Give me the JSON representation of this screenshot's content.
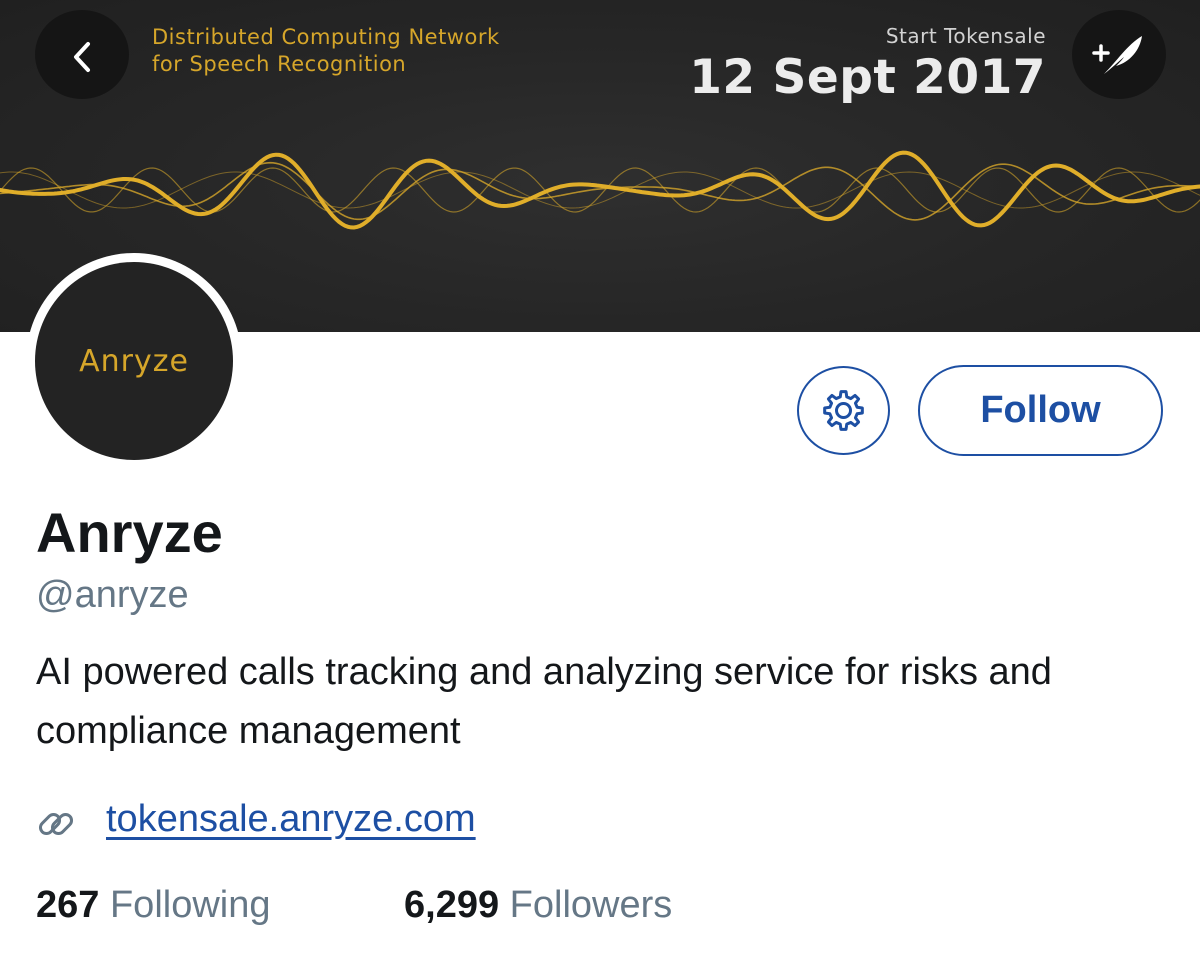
{
  "banner": {
    "tagline_line1": "Distributed Computing Network",
    "tagline_line2": "for Speech Recognition",
    "tokensale_label": "Start Tokensale",
    "tokensale_date": "12 Sept 2017",
    "wave_color": "#e0ae2a",
    "background_color": "#262626"
  },
  "nav": {
    "back_icon": "chevron-left-icon",
    "compose_icon": "compose-quill-icon"
  },
  "profile": {
    "avatar_text": "Anryze",
    "name": "Anryze",
    "handle": "@anryze",
    "bio": "AI powered calls tracking and analyzing service for risks and compliance management",
    "link": "tokensale.anryze.com",
    "link_icon": "link-icon"
  },
  "actions": {
    "settings_icon": "gear-icon",
    "follow_label": "Follow",
    "accent_color": "#1d4fa3"
  },
  "stats": {
    "following_count": "267",
    "following_label": "Following",
    "followers_count": "6,299",
    "followers_label": "Followers"
  }
}
